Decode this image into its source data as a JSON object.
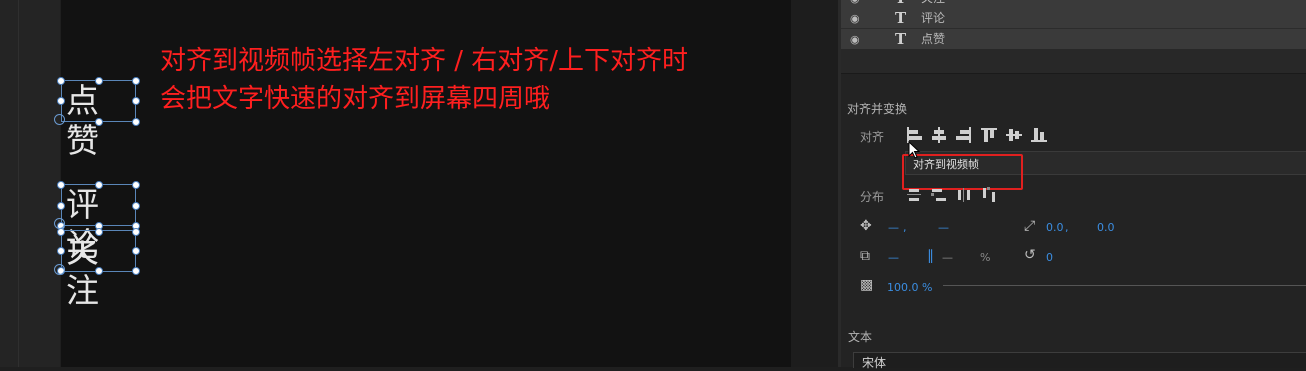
{
  "monitor": {
    "texts": [
      "点赞",
      "评论",
      "关注"
    ]
  },
  "annotation": {
    "line1": "对齐到视频帧选择左对齐 / 右对齐/上下对齐时",
    "line2": "会把文字快速的对齐到屏幕四周哦"
  },
  "layers": [
    {
      "name": "关注",
      "icon": "eye-icon",
      "type": "T"
    },
    {
      "name": "评论",
      "icon": "eye-icon",
      "type": "T"
    },
    {
      "name": "点赞",
      "icon": "eye-icon",
      "type": "T"
    }
  ],
  "align_section": {
    "title": "对齐并变换",
    "align_label": "对齐",
    "tooltip": "对齐到视频帧",
    "distribute_label": "分布",
    "icons": [
      "align-left-icon",
      "align-center-h-icon",
      "align-right-icon",
      "align-top-icon",
      "align-center-v-icon",
      "align-bottom-icon"
    ]
  },
  "transform": {
    "position_x": "—",
    "position_sep": ",",
    "position_y": "—",
    "anchor_x": "0.0",
    "anchor_sep": ",",
    "anchor_y": "0.0",
    "scale": "—",
    "scale_right": "—",
    "scale_unit": "%",
    "rotation": "0",
    "opacity": "100.0 %"
  },
  "text_section": {
    "title": "文本",
    "font": "宋体"
  },
  "colors": {
    "annotation": "#ff1f1f",
    "highlight_box": "#e0201f",
    "value_blue": "#3b8de0"
  }
}
